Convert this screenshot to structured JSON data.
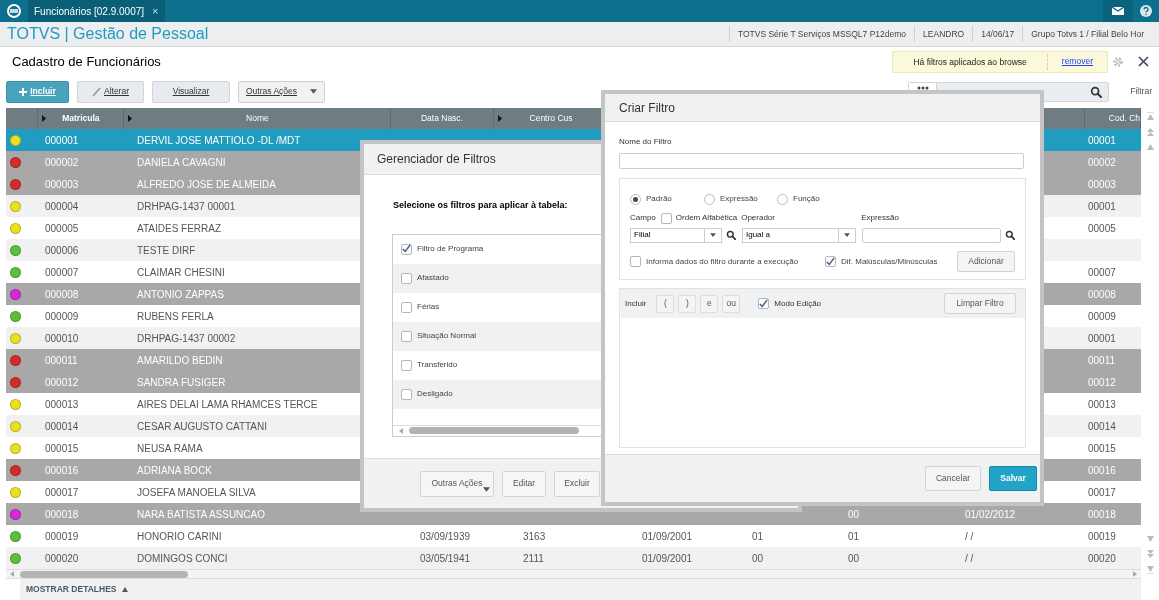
{
  "app_bar": {
    "tab": {
      "label": "Funcionários [02.9.0007]",
      "close": "×"
    }
  },
  "header": {
    "product": "TOTVS | Gestão de Pessoal",
    "info": [
      "TOTVS Série T Serviços MSSQL7 P12demo",
      "LEANDRO",
      "14/06/17",
      "Grupo Totvs 1 / Filial Belo Hor"
    ]
  },
  "page_title": "Cadastro de Funcionários",
  "filter_notice": {
    "text": "Há filtros aplicados ao browse",
    "link": "remover"
  },
  "toolbar": {
    "buttons": [
      {
        "label": "Incluir",
        "kind": "primary"
      },
      {
        "label": "Alterar",
        "kind": "edit"
      },
      {
        "label": "Visualizar",
        "kind": "plain"
      },
      {
        "label": "Outras Ações",
        "kind": "menu"
      }
    ]
  },
  "search": {
    "button_label": "Filtrar"
  },
  "grid": {
    "columns": [
      "Matricula",
      "Nome",
      "Data Nasc.",
      "Centro Cus",
      "Cod. Ch"
    ],
    "rows": [
      {
        "color": "#e8e020",
        "selected": true,
        "inactive": false,
        "matricula": "000001",
        "nome": "DERVIL JOSE MATTIOLO -DL /MDT",
        "cod": "00001"
      },
      {
        "color": "#d62b2b",
        "selected": false,
        "inactive": true,
        "matricula": "000002",
        "nome": "DANIELA CAVAGNI",
        "cod": "00002"
      },
      {
        "color": "#d62b2b",
        "selected": false,
        "inactive": true,
        "matricula": "000003",
        "nome": "ALFREDO JOSE DE ALMEIDA",
        "cod": "00003"
      },
      {
        "color": "#e8e020",
        "selected": false,
        "inactive": false,
        "matricula": "000004",
        "nome": "DRHPAG-1437 00001",
        "cod": "00001"
      },
      {
        "color": "#e8e020",
        "selected": false,
        "inactive": false,
        "matricula": "000005",
        "nome": "ATAIDES FERRAZ",
        "cod": "00005"
      },
      {
        "color": "#5cbf3a",
        "selected": false,
        "inactive": false,
        "matricula": "000006",
        "nome": "TESTE DIRF"
      },
      {
        "color": "#5cbf3a",
        "selected": false,
        "inactive": false,
        "matricula": "000007",
        "nome": "CLAIMAR CHESINI",
        "cod": "00007"
      },
      {
        "color": "#d62ad6",
        "selected": false,
        "inactive": true,
        "matricula": "000008",
        "nome": "ANTONIO ZAPPAS",
        "cod": "00008"
      },
      {
        "color": "#5cbf3a",
        "selected": false,
        "inactive": false,
        "matricula": "000009",
        "nome": "RUBENS FERLA",
        "cod": "00009"
      },
      {
        "color": "#e8e020",
        "selected": false,
        "inactive": false,
        "matricula": "000010",
        "nome": "DRHPAG-1437 00002",
        "cod": "00001"
      },
      {
        "color": "#d62b2b",
        "selected": false,
        "inactive": true,
        "matricula": "000011",
        "nome": "AMARILDO BEDIN",
        "cod": "00011"
      },
      {
        "color": "#d62b2b",
        "selected": false,
        "inactive": true,
        "matricula": "000012",
        "nome": "SANDRA FUSIGER",
        "cod": "00012"
      },
      {
        "color": "#e8e020",
        "selected": false,
        "inactive": false,
        "matricula": "000013",
        "nome": "AIRES DELAI LAMA RHAMCES TERCE",
        "cod": "00013"
      },
      {
        "color": "#e8e020",
        "selected": false,
        "inactive": false,
        "matricula": "000014",
        "nome": "CESAR AUGUSTO CATTANI",
        "cod": "00014"
      },
      {
        "color": "#e8e020",
        "selected": false,
        "inactive": false,
        "matricula": "000015",
        "nome": "NEUSA RAMA",
        "cod": "00015"
      },
      {
        "color": "#d62b2b",
        "selected": false,
        "inactive": true,
        "matricula": "000016",
        "nome": "ADRIANA BOCK",
        "cod": "00016"
      },
      {
        "color": "#e8e020",
        "selected": false,
        "inactive": false,
        "matricula": "000017",
        "nome": "JOSEFA MANOELA SILVA",
        "cod": "00017"
      },
      {
        "color": "#d62ad6",
        "selected": false,
        "inactive": true,
        "matricula": "000018",
        "nome": "NARA BATISTA ASSUNCAO",
        "column_7": "00",
        "column_8": "01/02/2012",
        "cod": "00018"
      },
      {
        "color": "#5cbf3a",
        "selected": false,
        "inactive": false,
        "matricula": "000019",
        "nome": "HONORIO CARINI",
        "data_nasc": "03/09/1939",
        "centro_custo": "3163",
        "column_5": "01/09/2001",
        "column_6": "01",
        "column_7": "01",
        "column_8": "/ /",
        "cod": "00019"
      },
      {
        "color": "#5cbf3a",
        "selected": false,
        "inactive": false,
        "matricula": "000020",
        "nome": "DOMINGOS CONCI",
        "data_nasc": "03/05/1941",
        "centro_custo": "2111",
        "column_5": "01/09/2001",
        "column_6": "00",
        "column_7": "00",
        "column_8": "/ /",
        "cod": "00020"
      }
    ]
  },
  "details_toggle": "MOSTRAR DETALHES",
  "filter_manager": {
    "title": "Gerenciador de Filtros",
    "prompt": "Selecione os filtros para aplicar à tabela:",
    "filters": [
      {
        "label": "Filtro de Programa",
        "checked": true
      },
      {
        "label": "Afastado",
        "checked": false
      },
      {
        "label": "Férias",
        "checked": false
      },
      {
        "label": "Situação Normal",
        "checked": false
      },
      {
        "label": "Transferido",
        "checked": false
      },
      {
        "label": "Desligado",
        "checked": false
      }
    ],
    "buttons": [
      {
        "label": "Outras Ações",
        "kind": "menu"
      },
      {
        "label": "Editar",
        "kind": "plain"
      },
      {
        "label": "Excluir",
        "kind": "plain"
      }
    ]
  },
  "create_filter": {
    "title": "Criar Filtro",
    "name_label": "Nome do Filtro",
    "modes": [
      {
        "label": "Padrão",
        "selected": true
      },
      {
        "label": "Expressão",
        "selected": false
      },
      {
        "label": "Função",
        "selected": false
      }
    ],
    "field_label": "Campo",
    "alphabetical": {
      "label": "Ordem Alfabética",
      "checked": false
    },
    "operator_label": "Operador",
    "expression_label": "Expressão",
    "field_value": "Filial",
    "operator_value": "Igual a",
    "ask_at_runtime": {
      "label": "Informa dados do filtro durante a execução",
      "checked": false
    },
    "case_sensitive": {
      "label": "Dif. Maiúsculas/Minúsculas",
      "checked": true
    },
    "add_button": "Adicionar",
    "builder": {
      "label": "Incluir",
      "tokens": [
        "(",
        ")",
        "e",
        "ou"
      ],
      "edit_mode": {
        "label": "Modo Edição",
        "checked": true
      },
      "clear_button": "Limpar Filtro"
    },
    "actions": [
      {
        "label": "Cancelar",
        "kind": "secondary"
      },
      {
        "label": "Salvar",
        "kind": "primary"
      }
    ]
  }
}
